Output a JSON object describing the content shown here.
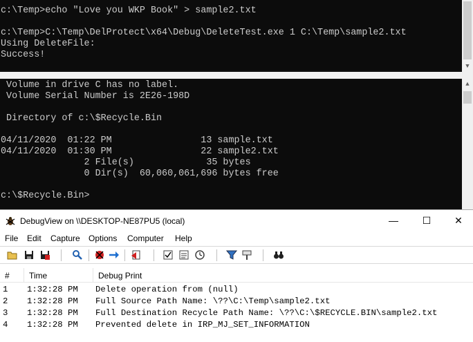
{
  "console_top": {
    "lines": [
      "c:\\Temp>echo \"Love you WKP Book\" > sample2.txt",
      "",
      "c:\\Temp>C:\\Temp\\DelProtect\\x64\\Debug\\DeleteTest.exe 1 C:\\Temp\\sample2.txt",
      "Using DeleteFile:",
      "Success!"
    ]
  },
  "console_bottom": {
    "lines": [
      " Volume in drive C has no label.",
      " Volume Serial Number is 2E26-198D",
      "",
      " Directory of c:\\$Recycle.Bin",
      "",
      "04/11/2020  01:22 PM                13 sample.txt",
      "04/11/2020  01:30 PM                22 sample2.txt",
      "               2 File(s)             35 bytes",
      "               0 Dir(s)  60,060,061,696 bytes free",
      "",
      "c:\\$Recycle.Bin>"
    ]
  },
  "debugview": {
    "title": "DebugView on \\\\DESKTOP-NE87PU5 (local)",
    "window_buttons": {
      "minimize": "—",
      "maximize": "☐",
      "close": "✕"
    },
    "menu": [
      "File",
      "Edit",
      "Capture",
      "Options",
      "Computer",
      "Help"
    ],
    "toolbar_icons": [
      "open-icon",
      "save-icon",
      "save-as-icon",
      "find-icon",
      "capture-icon",
      "autoscroll-icon",
      "clear-icon",
      "time-format-icon",
      "clock-time-icon",
      "filter-icon",
      "highlight-icon",
      "binoculars-icon"
    ],
    "columns": [
      "#",
      "Time",
      "Debug Print"
    ],
    "rows": [
      {
        "num": "1",
        "time": "1:32:28 PM",
        "msg": "Delete operation from (null)"
      },
      {
        "num": "2",
        "time": "1:32:28 PM",
        "msg": "Full Source Path Name: \\??\\C:\\Temp\\sample2.txt"
      },
      {
        "num": "3",
        "time": "1:32:28 PM",
        "msg": "Full Destination Recycle Path Name: \\??\\C:\\$RECYCLE.BIN\\sample2.txt"
      },
      {
        "num": "4",
        "time": "1:32:28 PM",
        "msg": "Prevented delete in IRP_MJ_SET_INFORMATION"
      }
    ]
  }
}
